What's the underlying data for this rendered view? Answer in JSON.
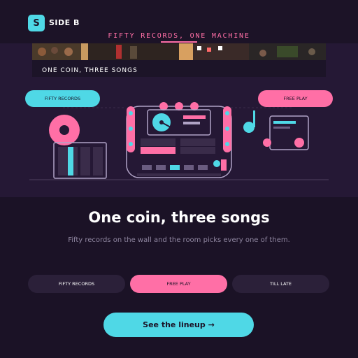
{
  "brand": {
    "badge": "S",
    "name": "SIDE B"
  },
  "tagline": "FIFTY RECORDS, ONE MACHINE",
  "banner": {
    "caption": "ONE COIN, THREE SONGS"
  },
  "hero": {
    "left_pill": "FIFTY RECORDS",
    "right_pill": "FREE PLAY"
  },
  "headline": "One coin, three songs",
  "subline": "Fifty records on the wall and the room picks every one of them.",
  "tabs": [
    {
      "label": "FIFTY RECORDS",
      "active": false
    },
    {
      "label": "FREE PLAY",
      "active": true
    },
    {
      "label": "TILL LATE",
      "active": false
    }
  ],
  "cta": {
    "label": "See the lineup →"
  },
  "colors": {
    "bg": "#1b1226",
    "accent_cyan": "#4fd8e6",
    "accent_pink": "#ff6fa6",
    "panel": "#251835"
  }
}
